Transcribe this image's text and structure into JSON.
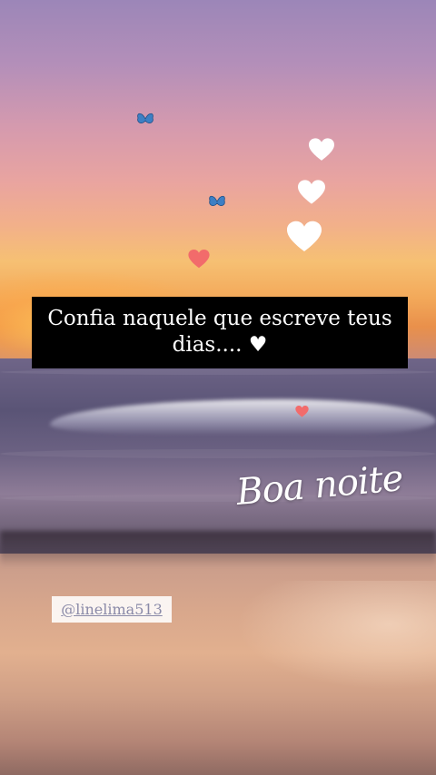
{
  "story": {
    "caption": "Confia naquele que escreve teus dias.... ♥",
    "greeting": "Boa noite",
    "handle": "@linelima513"
  },
  "stickers": [
    {
      "icon": "butterfly-icon",
      "color": "#3d7fc4"
    },
    {
      "icon": "butterfly-icon",
      "color": "#3d7fc4"
    },
    {
      "icon": "heart-icon",
      "color": "#ffffff"
    },
    {
      "icon": "heart-icon",
      "color": "#ffffff"
    },
    {
      "icon": "heart-icon",
      "color": "#ffffff"
    },
    {
      "icon": "heart-icon",
      "color": "#f26b6b"
    },
    {
      "icon": "heart-icon",
      "color": "#f26b6b"
    }
  ]
}
